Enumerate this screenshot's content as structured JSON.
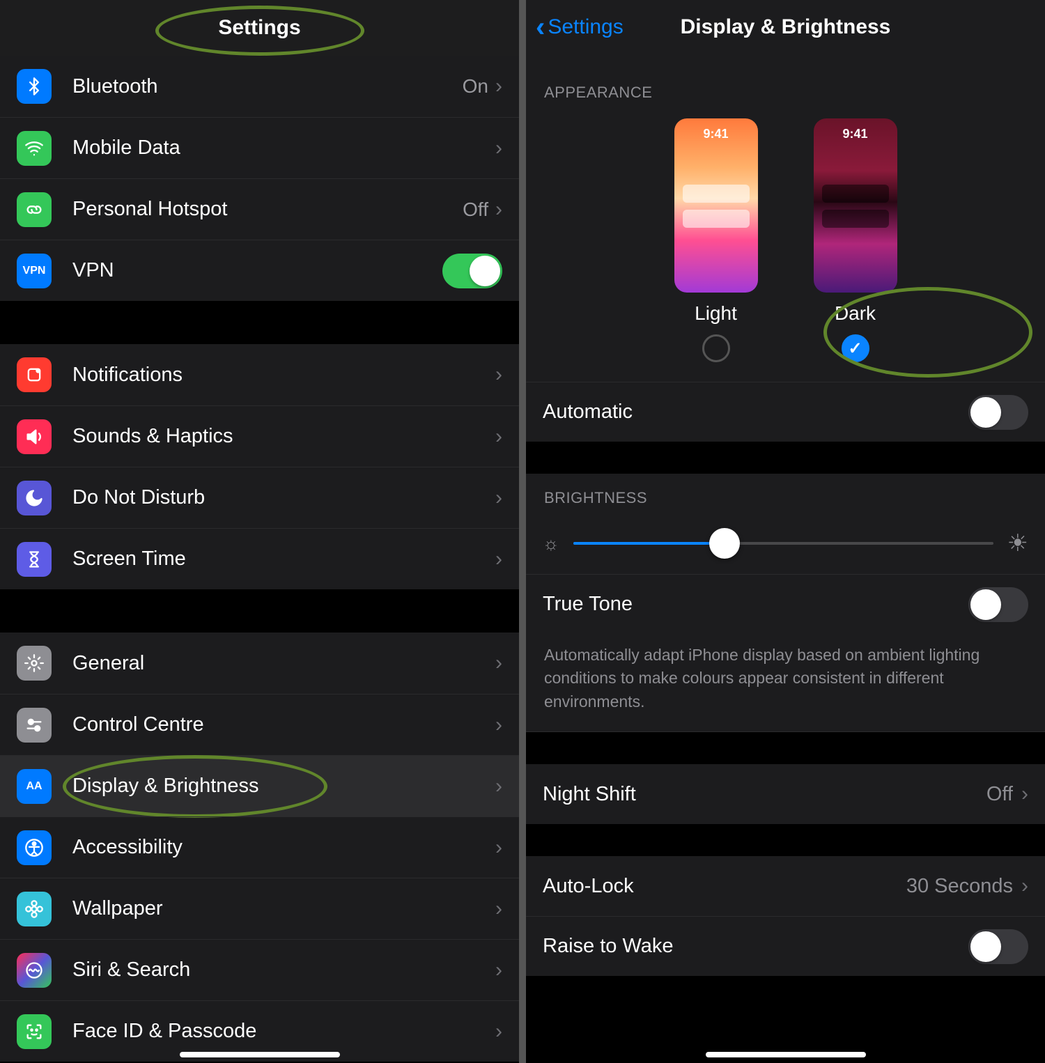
{
  "left": {
    "title": "Settings",
    "groups": [
      [
        {
          "icon": "bluetooth",
          "iconClass": "ic-bt",
          "iconText": "",
          "svg": "bt",
          "label": "Bluetooth",
          "value": "On",
          "chev": true,
          "toggle": null,
          "name": "row-bluetooth"
        },
        {
          "icon": "signal",
          "iconClass": "ic-md",
          "iconText": "",
          "svg": "sig",
          "label": "Mobile Data",
          "value": "",
          "chev": true,
          "toggle": null,
          "name": "row-mobile-data"
        },
        {
          "icon": "link",
          "iconClass": "ic-ph",
          "iconText": "",
          "svg": "link",
          "label": "Personal Hotspot",
          "value": "Off",
          "chev": true,
          "toggle": null,
          "name": "row-personal-hotspot"
        },
        {
          "icon": "vpn",
          "iconClass": "ic-vpn",
          "iconText": "VPN",
          "svg": "",
          "label": "VPN",
          "value": "",
          "chev": false,
          "toggle": true,
          "name": "row-vpn"
        }
      ],
      [
        {
          "icon": "notif",
          "iconClass": "ic-nt",
          "iconText": "",
          "svg": "sq",
          "label": "Notifications",
          "value": "",
          "chev": true,
          "toggle": null,
          "name": "row-notifications"
        },
        {
          "icon": "sound",
          "iconClass": "ic-sh",
          "iconText": "",
          "svg": "snd",
          "label": "Sounds & Haptics",
          "value": "",
          "chev": true,
          "toggle": null,
          "name": "row-sounds-haptics"
        },
        {
          "icon": "moon",
          "iconClass": "ic-dnd",
          "iconText": "",
          "svg": "moon",
          "label": "Do Not Disturb",
          "value": "",
          "chev": true,
          "toggle": null,
          "name": "row-do-not-disturb"
        },
        {
          "icon": "hourglass",
          "iconClass": "ic-st",
          "iconText": "",
          "svg": "hg",
          "label": "Screen Time",
          "value": "",
          "chev": true,
          "toggle": null,
          "name": "row-screen-time"
        }
      ],
      [
        {
          "icon": "gear",
          "iconClass": "ic-gn",
          "iconText": "",
          "svg": "gear",
          "label": "General",
          "value": "",
          "chev": true,
          "toggle": null,
          "name": "row-general"
        },
        {
          "icon": "switches",
          "iconClass": "ic-cc",
          "iconText": "",
          "svg": "sw",
          "label": "Control Centre",
          "value": "",
          "chev": true,
          "toggle": null,
          "name": "row-control-centre"
        },
        {
          "icon": "aa",
          "iconClass": "ic-db",
          "iconText": "AA",
          "svg": "",
          "label": "Display & Brightness",
          "value": "",
          "chev": true,
          "toggle": null,
          "highlight": true,
          "circle": true,
          "name": "row-display-brightness"
        },
        {
          "icon": "person",
          "iconClass": "ic-ac",
          "iconText": "",
          "svg": "acc",
          "label": "Accessibility",
          "value": "",
          "chev": true,
          "toggle": null,
          "name": "row-accessibility"
        },
        {
          "icon": "flower",
          "iconClass": "ic-wp",
          "iconText": "",
          "svg": "flw",
          "label": "Wallpaper",
          "value": "",
          "chev": true,
          "toggle": null,
          "name": "row-wallpaper"
        },
        {
          "icon": "siri",
          "iconClass": "ic-ss",
          "iconText": "",
          "svg": "siri",
          "label": "Siri & Search",
          "value": "",
          "chev": true,
          "toggle": null,
          "name": "row-siri-search"
        },
        {
          "icon": "face",
          "iconClass": "ic-fid",
          "iconText": "",
          "svg": "face",
          "label": "Face ID & Passcode",
          "value": "",
          "chev": true,
          "toggle": null,
          "name": "row-faceid-passcode"
        }
      ]
    ]
  },
  "right": {
    "back": "Settings",
    "title": "Display & Brightness",
    "appearance_h": "APPEARANCE",
    "modes": {
      "light": {
        "label": "Light",
        "time": "9:41",
        "selected": false
      },
      "dark": {
        "label": "Dark",
        "time": "9:41",
        "selected": true
      }
    },
    "automatic": {
      "label": "Automatic",
      "on": false
    },
    "brightness_h": "BRIGHTNESS",
    "brightness_pct": 36,
    "truetone": {
      "label": "True Tone",
      "on": false
    },
    "truetone_desc": "Automatically adapt iPhone display based on ambient lighting conditions to make colours appear consistent in different environments.",
    "nightshift": {
      "label": "Night Shift",
      "value": "Off"
    },
    "autolock": {
      "label": "Auto-Lock",
      "value": "30 Seconds"
    },
    "raise": {
      "label": "Raise to Wake",
      "on": false
    }
  }
}
